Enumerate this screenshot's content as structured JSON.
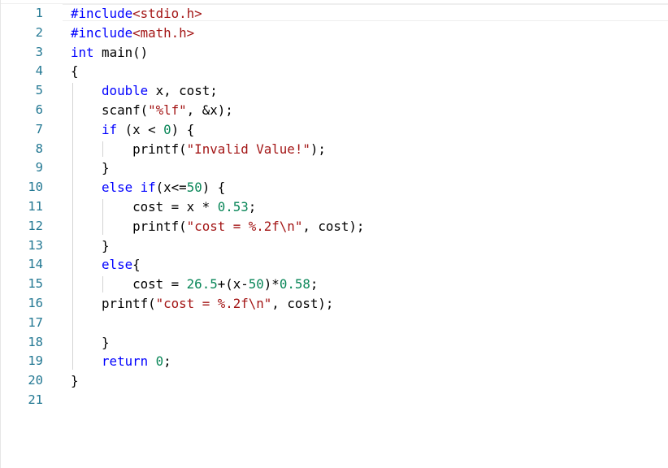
{
  "editor": {
    "lines": [
      {
        "num": "1",
        "text": "#include<stdio.h>"
      },
      {
        "num": "2",
        "text": "#include<math.h>"
      },
      {
        "num": "3",
        "text": "int main()"
      },
      {
        "num": "4",
        "text": "{"
      },
      {
        "num": "5",
        "text": "    double x, cost;"
      },
      {
        "num": "6",
        "text": "    scanf(\"%lf\", &x);"
      },
      {
        "num": "7",
        "text": "    if (x < 0) {"
      },
      {
        "num": "8",
        "text": "        printf(\"Invalid Value!\");"
      },
      {
        "num": "9",
        "text": "    }"
      },
      {
        "num": "10",
        "text": "    else if(x<=50) {"
      },
      {
        "num": "11",
        "text": "        cost = x * 0.53;"
      },
      {
        "num": "12",
        "text": "        printf(\"cost = %.2f\\n\", cost);"
      },
      {
        "num": "13",
        "text": "    }"
      },
      {
        "num": "14",
        "text": "    else{"
      },
      {
        "num": "15",
        "text": "        cost = 26.5+(x-50)*0.58;"
      },
      {
        "num": "16",
        "text": "    printf(\"cost = %.2f\\n\", cost);"
      },
      {
        "num": "17",
        "text": ""
      },
      {
        "num": "18",
        "text": "    }"
      },
      {
        "num": "19",
        "text": "    return 0;"
      },
      {
        "num": "20",
        "text": "}"
      },
      {
        "num": "21",
        "text": ""
      }
    ]
  },
  "colors": {
    "line_number": "#237893",
    "keyword": "#0000ff",
    "string": "#a31515",
    "number": "#098658",
    "text": "#000000"
  }
}
